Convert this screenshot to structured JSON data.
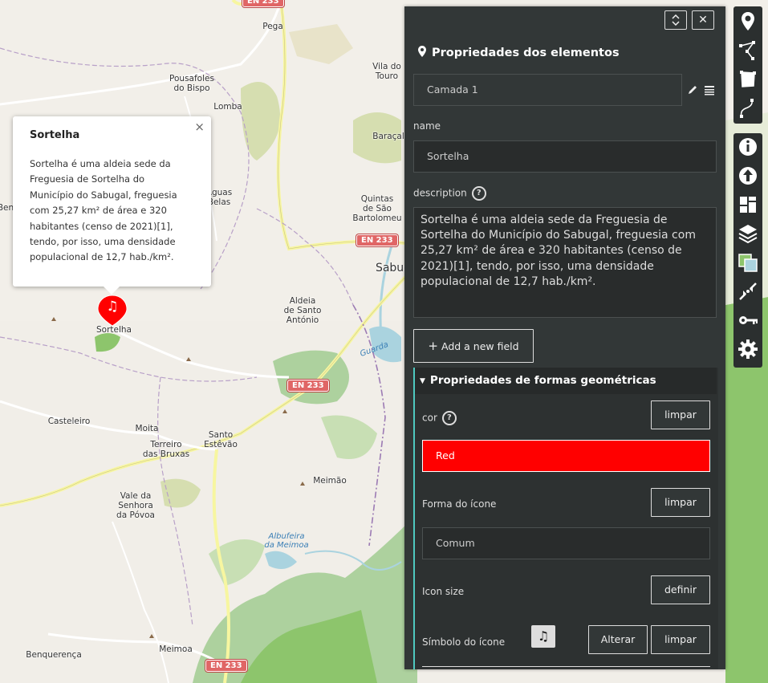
{
  "map": {
    "places": [
      {
        "name": "Pega",
        "key": "pega"
      },
      {
        "name": "Pousafoles\ndo Bispo",
        "key": "pousafoles"
      },
      {
        "name": "Lomba",
        "key": "lomba"
      },
      {
        "name": "Vila do\nTouro",
        "key": "vilatouro"
      },
      {
        "name": "Baraçal",
        "key": "baracal"
      },
      {
        "name": "Quintas\nde São\nBartolomeu",
        "key": "quintas"
      },
      {
        "name": "Águas\nBelas",
        "key": "aguasbelas"
      },
      {
        "name": "Sortelha",
        "key": "sortelha"
      },
      {
        "name": "Aldeia\nde Santo\nAntónio",
        "key": "aldeia"
      },
      {
        "name": "Sabug",
        "key": "sabugal"
      },
      {
        "name": "Casteleiro",
        "key": "casteleiro"
      },
      {
        "name": "Moita",
        "key": "moita"
      },
      {
        "name": "Santo\nEstêvão",
        "key": "santo"
      },
      {
        "name": "Terreiro\ndas Bruxas",
        "key": "terreiro"
      },
      {
        "name": "Meimão",
        "key": "meimao"
      },
      {
        "name": "Vale da\nSenhora\nda Póvoa",
        "key": "vale"
      },
      {
        "name": "Meimoa",
        "key": "meimoa"
      },
      {
        "name": "Benquerença",
        "key": "benquerenca"
      },
      {
        "name": "Ben",
        "key": "ben"
      }
    ],
    "water": {
      "albufeira": "Albufeira\nda Meimoa",
      "river": "Guarda"
    },
    "roads": [
      "EN 233",
      "EN 233",
      "EN 233",
      "EN 233"
    ]
  },
  "popup": {
    "title": "Sortelha",
    "close": "×",
    "text": "Sortelha é uma aldeia sede da Freguesia de Sortelha do Município do Sabugal, freguesia com 25,27 km² de área e 320 habitantes (censo de 2021)[1], tendo, por isso, uma densidade populacional de 12,7 hab./km²."
  },
  "marker": {
    "symbol": "♫",
    "color": "#ff0000"
  },
  "panel": {
    "title": "Propriedades dos elementos",
    "layer_select": "Camada 1",
    "name_label": "name",
    "name_value": "Sortelha",
    "description_label": "description",
    "description_value": "Sortelha é uma aldeia sede da Freguesia de Sortelha do Município do Sabugal, freguesia com 25,27 km² de área e 320 habitantes (censo de 2021)[1], tendo, por isso, uma densidade populacional de 12,7 hab./km².",
    "add_field": "Add a new field",
    "add_field_icon": "+",
    "geo_title": "Propriedades de formas geométricas",
    "cor_label": "cor",
    "cor_value": "Red",
    "cor_color": "#ff0000",
    "limpar": "limpar",
    "icon_shape_label": "Forma do ícone",
    "icon_shape_value": "Comum",
    "icon_size_label": "Icon size",
    "definir": "definir",
    "icon_symbol_label": "Símbolo do ícone",
    "icon_symbol": "♫",
    "alterar": "Alterar",
    "close": "✕",
    "toggle": "⌃⌄"
  },
  "toolbar": {
    "icons": [
      "marker-icon",
      "polyline-icon",
      "polygon-icon",
      "route-icon",
      "info-icon",
      "upload-icon",
      "templates-icon",
      "layers-icon",
      "tilelayer-icon",
      "fit-icon",
      "key-icon",
      "settings-icon"
    ]
  }
}
